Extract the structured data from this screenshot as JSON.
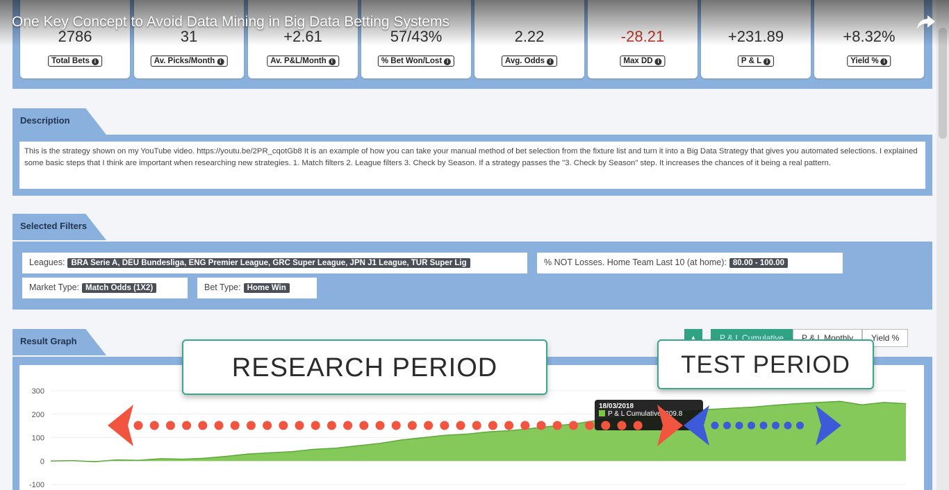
{
  "video": {
    "title": "One Key Concept to Avoid Data Mining in Big Data Betting Systems",
    "share_icon": "share-arrow-icon"
  },
  "stats": [
    {
      "value": "2786",
      "label": "Total Bets",
      "negative": false
    },
    {
      "value": "31",
      "label": "Av. Picks/Month",
      "negative": false
    },
    {
      "value": "+2.61",
      "label": "Av. P&L/Month",
      "negative": false
    },
    {
      "value": "57/43%",
      "label": "% Bet Won/Lost",
      "negative": false
    },
    {
      "value": "2.22",
      "label": "Avg. Odds",
      "negative": false
    },
    {
      "value": "-28.21",
      "label": "Max DD",
      "negative": true
    },
    {
      "value": "+231.89",
      "label": "P & L",
      "negative": false
    },
    {
      "value": "+8.32%",
      "label": "Yield %",
      "negative": false
    }
  ],
  "info_glyph": "i",
  "description": {
    "tab": "Description",
    "text": "This is the strategy shown on my YouTube video. https://youtu.be/2PR_cqotGb8 It is an example of how you can take your manual method of bet selection from the fixture list and turn it into a Big Data Strategy that gives you automated selections. I explained some basic steps that I think are important when researching new strategies. 1. Match filters 2. League filters 3. Check by Season. If a strategy passes the \"3. Check by Season\" step. It increases the chances of it being a real pattern."
  },
  "filters": {
    "tab": "Selected Filters",
    "leagues_label": "Leagues:",
    "leagues_value": "BRA Serie A, DEU Bundesliga, ENG Premier League, GRC Super League, JPN J1 League, TUR Super Lig",
    "not_losses_label": "% NOT Losses. Home Team Last 10 (at home):",
    "not_losses_value": "80.00 - 100.00",
    "market_label": "Market Type:",
    "market_value": "Match Odds (1X2)",
    "bet_label": "Bet Type:",
    "bet_value": "Home Win"
  },
  "graph": {
    "tab": "Result Graph",
    "buttons": {
      "small": "▲",
      "cumulative": "P & L Cumulative",
      "monthly": "P & L Monthly",
      "yield": "Yield %"
    },
    "research_banner": "RESEARCH PERIOD",
    "test_banner": "TEST PERIOD",
    "tooltip_date": "18/03/2018",
    "tooltip_series": "P & L Cumulative: 209.8"
  },
  "chart_data": {
    "type": "area",
    "ylim": [
      -100,
      300
    ],
    "yticks": [
      "300",
      "200",
      "100",
      "0",
      "-100"
    ],
    "series": [
      {
        "name": "P & L Cumulative",
        "values": [
          0,
          2,
          -3,
          5,
          3,
          10,
          8,
          12,
          20,
          30,
          35,
          40,
          50,
          55,
          65,
          75,
          90,
          100,
          110,
          115,
          125,
          130,
          140,
          150,
          160,
          175,
          185,
          195,
          205,
          210,
          220,
          225,
          230,
          238,
          245,
          250,
          255,
          240,
          250,
          245
        ]
      }
    ],
    "colors": {
      "area": "#84c95a",
      "line": "#5ea83a"
    }
  }
}
